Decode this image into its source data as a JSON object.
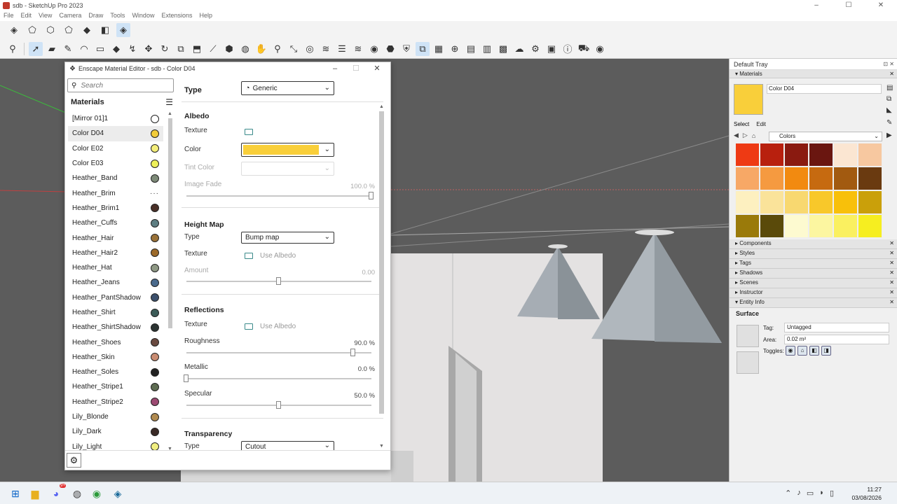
{
  "window": {
    "title": "sdb - SketchUp Pro 2023",
    "min": "–",
    "max": "☐",
    "close": "✕"
  },
  "menu": [
    "File",
    "Edit",
    "View",
    "Camera",
    "Draw",
    "Tools",
    "Window",
    "Extensions",
    "Help"
  ],
  "editor": {
    "title": "Enscape Material Editor - sdb - Color D04",
    "search_placeholder": "Search",
    "materials_header": "Materials",
    "materials": [
      {
        "name": "[Mirror 01]1",
        "color": "#ffffff"
      },
      {
        "name": "Color D04",
        "color": "#f2cc3a",
        "selected": true
      },
      {
        "name": "Color E02",
        "color": "#f4ee7a"
      },
      {
        "name": "Color E03",
        "color": "#eef05a"
      },
      {
        "name": "Heather_Band",
        "color": "#7d8a78"
      },
      {
        "name": "Heather_Brim",
        "color": "",
        "more": "···"
      },
      {
        "name": "Heather_Brim1",
        "color": "#4a3028"
      },
      {
        "name": "Heather_Cuffs",
        "color": "#5e7e82"
      },
      {
        "name": "Heather_Hair",
        "color": "#9a7238"
      },
      {
        "name": "Heather_Hair2",
        "color": "#9c6a2a"
      },
      {
        "name": "Heather_Hat",
        "color": "#8e9884"
      },
      {
        "name": "Heather_Jeans",
        "color": "#4a6a8c"
      },
      {
        "name": "Heather_PantShadow",
        "color": "#3c506c"
      },
      {
        "name": "Heather_Shirt",
        "color": "#3c5c58"
      },
      {
        "name": "Heather_ShirtShadow",
        "color": "#2c3432"
      },
      {
        "name": "Heather_Shoes",
        "color": "#6a4a40"
      },
      {
        "name": "Heather_Skin",
        "color": "#c98c72"
      },
      {
        "name": "Heather_Soles",
        "color": "#222222"
      },
      {
        "name": "Heather_Stripe1",
        "color": "#5e6c52"
      },
      {
        "name": "Heather_Stripe2",
        "color": "#9c4a72"
      },
      {
        "name": "Lily_Blonde",
        "color": "#b08a50"
      },
      {
        "name": "Lily_Dark",
        "color": "#3a2a26"
      },
      {
        "name": "Lily_Light",
        "color": "#f0ee80"
      }
    ],
    "type_label": "Type",
    "type_value": "Generic",
    "albedo": {
      "title": "Albedo",
      "texture_label": "Texture",
      "color_label": "Color",
      "color_value": "#f9cf3a",
      "tint_label": "Tint Color",
      "fade_label": "Image Fade",
      "fade_value": "100.0 %",
      "fade_level": 1.0
    },
    "height_map": {
      "title": "Height Map",
      "type_label": "Type",
      "type_value": "Bump map",
      "texture_label": "Texture",
      "texture_value": "Use Albedo",
      "amount_label": "Amount",
      "amount_value": "0.00",
      "amount_level": 0.5
    },
    "reflections": {
      "title": "Reflections",
      "texture_label": "Texture",
      "texture_value": "Use Albedo",
      "roughness_label": "Roughness",
      "roughness_value": "90.0 %",
      "roughness_level": 0.9,
      "metallic_label": "Metallic",
      "metallic_value": "0.0 %",
      "metallic_level": 0.0,
      "specular_label": "Specular",
      "specular_value": "50.0 %",
      "specular_level": 0.5
    },
    "transparency": {
      "title": "Transparency",
      "type_label": "Type",
      "type_value": "Cutout"
    }
  },
  "tray": {
    "title": "Default Tray",
    "materials_header": "Materials",
    "material_name": "Color D04",
    "preview_color": "#f9cf3a",
    "tab_select": "Select",
    "tab_edit": "Edit",
    "library": "Colors",
    "palette": [
      "#ee3a14",
      "#b8200e",
      "#8a1a10",
      "#6a1610",
      "#fbe6d2",
      "#f7c8a0",
      "#f7a866",
      "#f59a40",
      "#f28a10",
      "#c66a10",
      "#a25a10",
      "#6a3a10",
      "#fdf0c0",
      "#fae39a",
      "#f8d870",
      "#f8c82a",
      "#f8c00a",
      "#caa00a",
      "#9a7a0a",
      "#5a4a0a",
      "#fdfad0",
      "#fcf6a0",
      "#faf060",
      "#f6ee20"
    ],
    "collapsed": [
      "Components",
      "Styles",
      "Tags",
      "Shadows",
      "Scenes",
      "Instructor",
      "Entity Info"
    ],
    "entity": {
      "title": "Surface",
      "tag_label": "Tag:",
      "tag_value": "Untagged",
      "area_label": "Area:",
      "area_value": "0.02 m²",
      "toggles_label": "Toggles:"
    }
  },
  "taskbar": {
    "time": "11:27",
    "date": "03/08/2026",
    "badge": "9+"
  }
}
